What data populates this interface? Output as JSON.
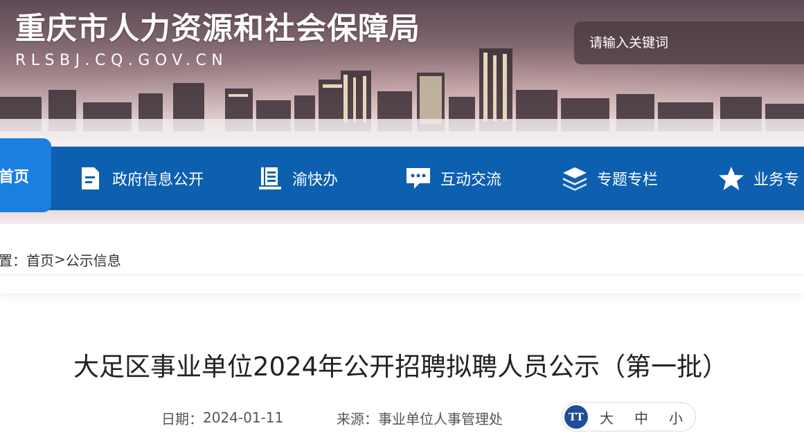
{
  "header": {
    "site_title": "重庆市人力资源和社会保障局",
    "site_domain": "RLSBJ.CQ.GOV.CN",
    "search_placeholder": "请输入关键词"
  },
  "nav": {
    "home": "首页",
    "items": [
      {
        "label": "政府信息公开",
        "icon": "document-icon"
      },
      {
        "label": "渝快办",
        "icon": "clipboard-icon"
      },
      {
        "label": "互动交流",
        "icon": "chat-bubble-icon"
      },
      {
        "label": "专题专栏",
        "icon": "layers-icon"
      },
      {
        "label": "业务专",
        "icon": "star-icon"
      }
    ]
  },
  "breadcrumb": {
    "prefix": "位置：",
    "home": "首页",
    "separator": ">",
    "current": "公示信息"
  },
  "article": {
    "title": "大足区事业单位2024年公开招聘拟聘人员公示（第一批）",
    "date_label": "日期：",
    "date": "2024-01-11",
    "source_label": "来源：",
    "source": "事业单位人事管理处",
    "font_sizes": {
      "icon_text": "TT",
      "large": "大",
      "medium": "中",
      "small": "小"
    }
  },
  "colors": {
    "nav_bg": "#0d5fb0",
    "nav_active": "#1a7fe0",
    "font_icon_bg": "#1f4d97"
  }
}
